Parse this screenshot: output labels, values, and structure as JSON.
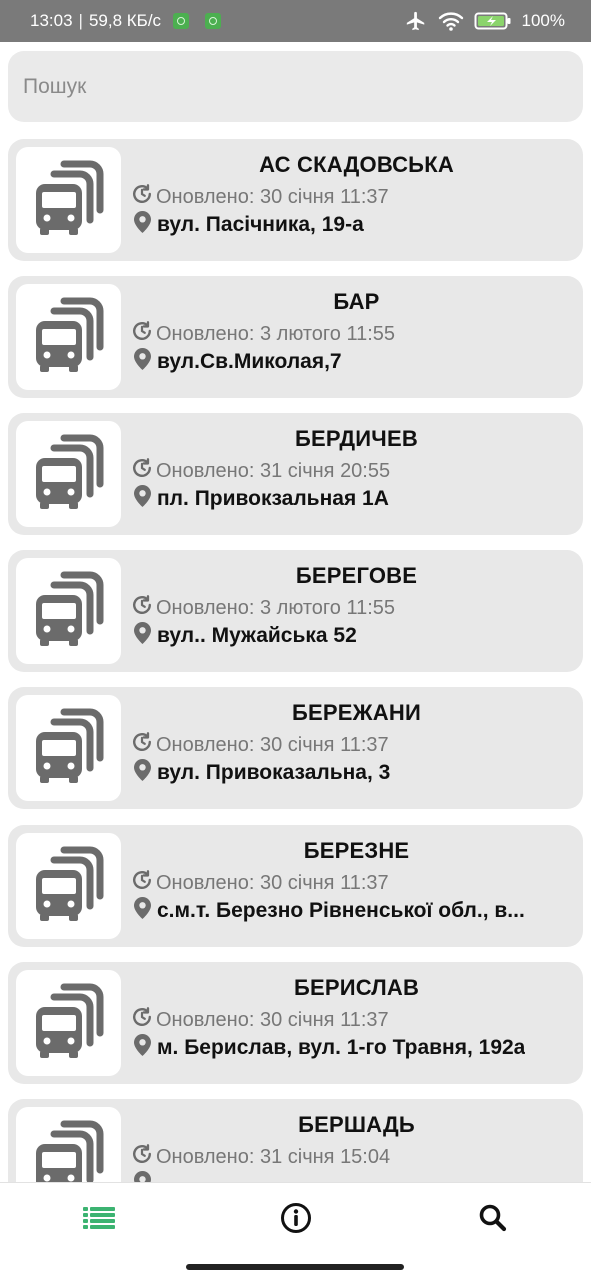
{
  "status_bar": {
    "time": "13:03",
    "separator": "|",
    "speed": "59,8 КБ/с",
    "battery": "100%",
    "icons": [
      "airplane-icon",
      "wifi-icon",
      "battery-charging-icon"
    ]
  },
  "search": {
    "placeholder": "Пошук",
    "value": ""
  },
  "stations": [
    {
      "name": "АС СКАДОВСЬКА",
      "updated": "Оновлено: 30 січня 11:37",
      "address": "вул. Пасічника, 19-а"
    },
    {
      "name": "БАР",
      "updated": "Оновлено: 3 лютого 11:55",
      "address": "вул.Св.Миколая,7"
    },
    {
      "name": "БЕРДИЧЕВ",
      "updated": "Оновлено: 31 січня 20:55",
      "address": "пл. Привокзальная 1А"
    },
    {
      "name": "БЕРЕГОВЕ",
      "updated": "Оновлено: 3 лютого 11:55",
      "address": "вул.. Мужайська 52"
    },
    {
      "name": "БЕРЕЖАНИ",
      "updated": "Оновлено: 30 січня 11:37",
      "address": "вул. Привоказальна, 3"
    },
    {
      "name": "БЕРЕЗНЕ",
      "updated": "Оновлено: 30 січня 11:37",
      "address": "с.м.т. Березно Рівненської обл., в..."
    },
    {
      "name": "БЕРИСЛАВ",
      "updated": "Оновлено: 30 січня 11:37",
      "address": "м. Берислав, вул. 1-го Травня, 192а"
    },
    {
      "name": "БЕРШАДЬ",
      "updated": "Оновлено: 31 січня 15:04",
      "address": ""
    }
  ],
  "bottom_nav": {
    "items": [
      {
        "icon": "list-icon",
        "active": true
      },
      {
        "icon": "info-icon",
        "active": false
      },
      {
        "icon": "search-icon",
        "active": false
      }
    ],
    "active_color": "#3cb371"
  },
  "colors": {
    "status_bar_bg": "#7a7a7a",
    "card_bg": "#e8e8e8",
    "icon_gray": "#6b6b6b"
  }
}
